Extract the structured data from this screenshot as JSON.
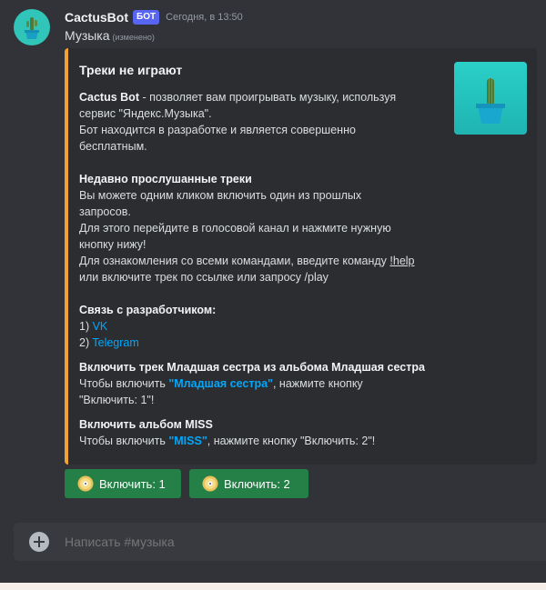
{
  "message": {
    "author": "CactusBot",
    "bot_tag": "БОТ",
    "timestamp": "Сегодня, в 13:50",
    "content": "Музыка",
    "edited": "(изменено)",
    "avatar_icon": "cactus-icon"
  },
  "embed": {
    "accent_color": "#f0a232",
    "title": "Треки не играют",
    "desc_bold": "Cactus Bot",
    "desc_line1_rest": " - позволяет вам проигрывать музыку, используя",
    "desc_line2": "сервис \"Яндекс.Музыка\".",
    "desc_line3": "Бот находится в разработке и является совершенно",
    "desc_line4": "бесплатным.",
    "recent_title": "Недавно прослушанные треки",
    "recent_line1": "Вы можете одним кликом включить один из прошлых",
    "recent_line2": "запросов.",
    "recent_line3": "Для этого перейдите в голосовой канал и нажмите нужную",
    "recent_line4": "кнопку нижу!",
    "recent_line5_pre": "Для ознакомления со всеми командами, введите команду ",
    "help_link": "!help",
    "recent_line6": "или включите трек по ссылке или запросу /play",
    "contact_title": "Связь с разработчиком:",
    "contact_1_prefix": "1) ",
    "contact_1_link": "VK",
    "contact_2_prefix": "2) ",
    "contact_2_link": "Telegram",
    "field1_name": "Включить трек Младшая сестра из альбома Младшая сестра",
    "field1_pre": "Чтобы включить ",
    "field1_highlight": "\"Младшая сестра\"",
    "field1_post": ", нажмите кнопку",
    "field1_line2": "\"Включить: 1\"!",
    "field2_name": "Включить альбом MISS",
    "field2_pre": "Чтобы включить ",
    "field2_highlight": "\"MISS\"",
    "field2_post": ", нажмите кнопку \"Включить: 2\"!",
    "thumbnail_icon": "cactus-icon"
  },
  "buttons": [
    {
      "label": "Включить: 1",
      "icon": "cd-icon"
    },
    {
      "label": "Включить: 2",
      "icon": "cd-icon"
    }
  ],
  "composer": {
    "placeholder": "Написать #музыка",
    "add_icon": "plus-circle-icon"
  },
  "colors": {
    "button_green": "#248046",
    "link_blue": "#00a8fc",
    "bot_tag": "#5865f2"
  }
}
